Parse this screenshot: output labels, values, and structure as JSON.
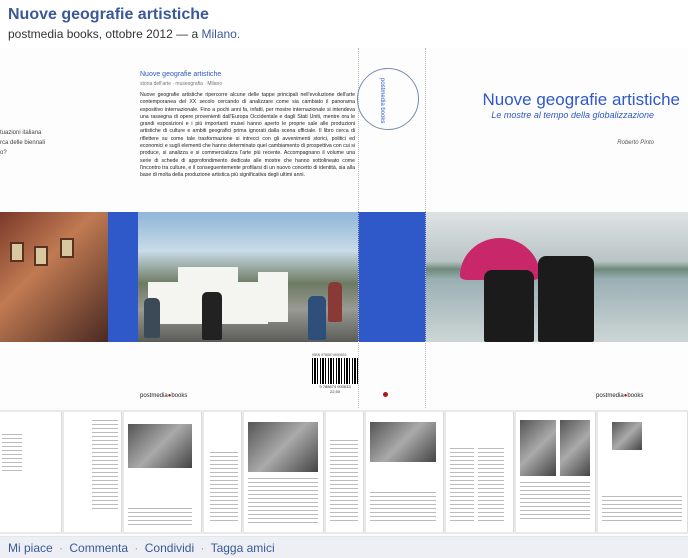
{
  "event": {
    "title": "Nuove geografie artistiche",
    "publisher_date": "postmedia books, ottobre 2012 —",
    "at": "a",
    "place": "Milano."
  },
  "photo": {
    "left_flap": {
      "lines": [
        "tuazioni italiana",
        "",
        "rca delle biennali",
        "",
        "o?"
      ]
    },
    "back_cover": {
      "title": "Nuove geografie artistiche",
      "subtitle": "storia dell'arte · museografia · Milano",
      "body": "Nuove geografie artistiche ripercorre alcune delle tappe principali nell'evoluzione dell'arte contemporanea del XX secolo cercando di analizzare come sia cambiato il panorama espositivo internazionale. Fino a pochi anni fa, infatti, per mostre internazionale si intendeva una rassegna di opere provenienti dall'Europa Occidentale e dagli Stati Uniti, mentre ora le grandi esposizioni e i più importanti musei hanno aperto le proprie sale alle produzioni artistiche di culture e ambiti geografici prima ignorati dalla scena ufficiale. Il libro cerca di riflettere su come tale trasformazione si intrecci con gli avvenimenti storici, politici ed economici e sugli elementi che hanno determinato quel cambiamento di prospettiva con cui si produce, si analizza e si commercializza l'arte più recente. Accompagnano il volume una serie di schede di approfondimento dedicate alle mostre che hanno sottolineato come l'incontro tra culture, e il conseguentemente profilarsi di un nuovo concetto di identità, sia alla base di molta della produzione artistica più significativa degli ultimi anni."
    },
    "spine": {
      "label": "postmedia books"
    },
    "front_cover": {
      "title": "Nuove geografie artistiche",
      "subtitle": "Le mostre al tempo della globalizzazione",
      "author": "Roberto Pinto"
    },
    "barcode": {
      "isbn": "ISBN 9788874900633",
      "digits": "9 788874 900633",
      "price": "22,50"
    },
    "publisher_logo": {
      "name": "postmedia",
      "suffix": "books"
    }
  },
  "actions": {
    "like": "Mi piace",
    "comment": "Commenta",
    "share": "Condividi",
    "tag": "Tagga amici"
  }
}
